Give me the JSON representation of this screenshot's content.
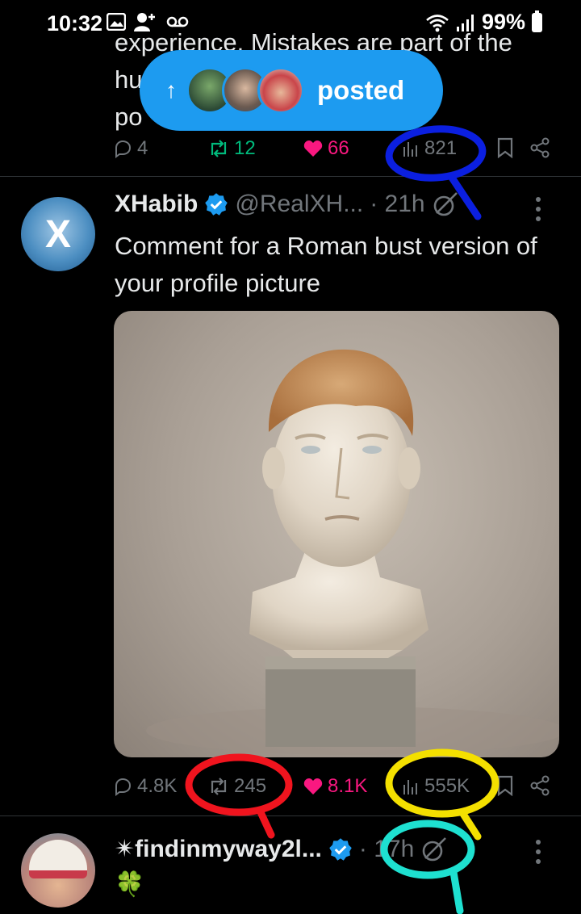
{
  "status_bar": {
    "time": "10:32",
    "battery": "99%",
    "icons": [
      "gallery-icon",
      "add-user-icon",
      "voicemail-icon",
      "wifi-icon",
      "signal-icon",
      "battery-icon"
    ]
  },
  "prev_tweet": {
    "text": "experience. Mistakes are part of the\nhu                                        You are so\npo",
    "actions": {
      "replies": "4",
      "reposts": "12",
      "likes": "66",
      "views": "821"
    }
  },
  "posted_banner": {
    "label": "posted"
  },
  "tweet": {
    "name": "XHabib",
    "handle": "@RealXH...",
    "time": "· 21h",
    "text": "Comment for a Roman bust version of your profile picture",
    "avatar_letter": "X",
    "actions": {
      "replies": "4.8K",
      "reposts": "245",
      "likes": "8.1K",
      "views": "555K"
    }
  },
  "next_tweet": {
    "name": "✴findinmyway2l...",
    "time": "· 17h",
    "text": "🍀"
  },
  "colors": {
    "background": "#000000",
    "text": "#e7e9ea",
    "muted": "#71767b",
    "accent": "#1d9bf0",
    "repost": "#00ba7c",
    "like": "#f91880",
    "annotation_blue": "#0b1fe0",
    "annotation_red": "#f0141e",
    "annotation_yellow": "#f4e000",
    "annotation_cyan": "#1ee0d0"
  }
}
